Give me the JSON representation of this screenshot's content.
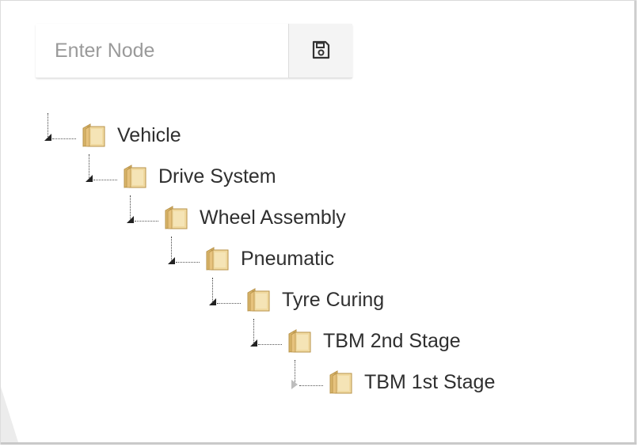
{
  "toolbar": {
    "node_input": {
      "value": "",
      "placeholder": "Enter Node"
    },
    "save_icon": "floppy-disk-icon"
  },
  "tree": {
    "nodes": [
      {
        "label": "Vehicle",
        "level": 0,
        "state": "expanded",
        "icon": "folder-icon"
      },
      {
        "label": "Drive System",
        "level": 1,
        "state": "expanded",
        "icon": "folder-icon"
      },
      {
        "label": "Wheel Assembly",
        "level": 2,
        "state": "expanded",
        "icon": "folder-icon"
      },
      {
        "label": "Pneumatic",
        "level": 3,
        "state": "expanded",
        "icon": "folder-icon"
      },
      {
        "label": "Tyre Curing",
        "level": 4,
        "state": "expanded",
        "icon": "folder-icon"
      },
      {
        "label": "TBM 2nd Stage",
        "level": 5,
        "state": "expanded",
        "icon": "folder-icon"
      },
      {
        "label": "TBM 1st Stage",
        "level": 6,
        "state": "collapsed",
        "icon": "folder-icon"
      }
    ]
  },
  "colors": {
    "folder_fill": "#f0d9a0",
    "folder_shade": "#d9b56a",
    "text": "#2f2f2f",
    "placeholder": "#9a9a9a"
  }
}
